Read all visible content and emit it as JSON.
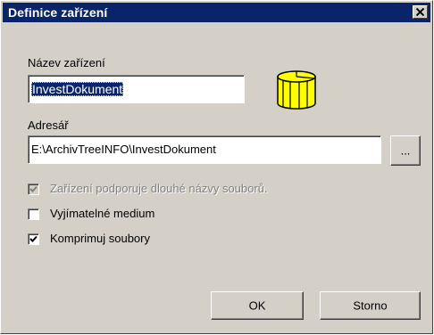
{
  "window": {
    "title": "Definice zařízení"
  },
  "device_name": {
    "label": "Název zařízení",
    "value": "InvestDokument"
  },
  "directory": {
    "label": "Adresář",
    "value": "E:\\ArchivTreeINFO\\InvestDokument",
    "browse_label": "..."
  },
  "options": {
    "long_names": {
      "label": "Zařízení podporuje dlouhé názvy souborů.",
      "checked": true,
      "enabled": false
    },
    "removable": {
      "label": "Vyjímatelné medium",
      "checked": false,
      "enabled": true
    },
    "compress": {
      "label": "Komprimuj soubory",
      "checked": true,
      "enabled": true
    }
  },
  "buttons": {
    "ok_label": "OK",
    "cancel_label": "Storno"
  },
  "icons": {
    "drive": "disk-drive-icon",
    "close": "close-icon",
    "check": "checkmark-icon"
  },
  "colors": {
    "titlebar": "#0a246a",
    "face": "#d4d0c8",
    "drive_icon": "#ffff00"
  }
}
